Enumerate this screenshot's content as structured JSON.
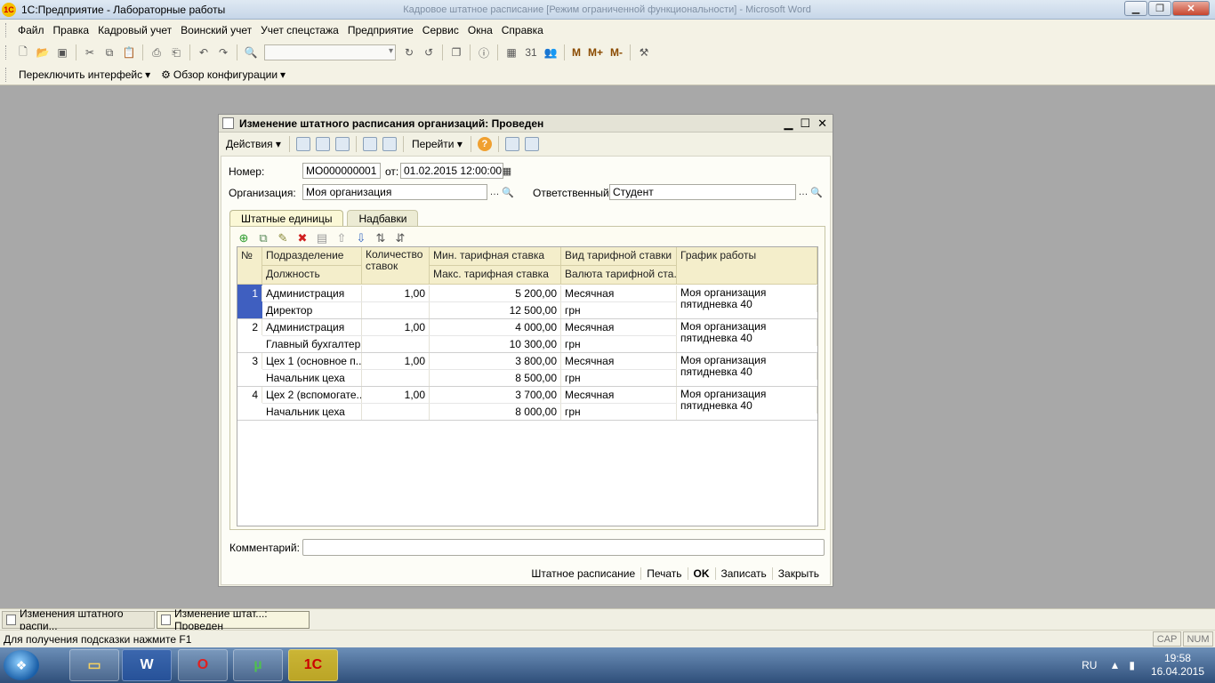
{
  "app": {
    "logo_text": "1С",
    "title": "1С:Предприятие - Лабораторные работы",
    "faded_title": "Кадровое штатное расписание [Режим ограниченной функциональности] - Microsoft Word"
  },
  "menu": {
    "items": [
      "Файл",
      "Правка",
      "Кадровый учет",
      "Воинский учет",
      "Учет спецстажа",
      "Предприятие",
      "Сервис",
      "Окна",
      "Справка"
    ]
  },
  "toolbar": {
    "m_labels": [
      "M",
      "M+",
      "M-"
    ]
  },
  "toolbar2": {
    "switch_interface": "Переключить интерфейс",
    "config_overview": "Обзор конфигурации"
  },
  "document": {
    "title": "Изменение штатного расписания организаций: Проведен",
    "toolbar": {
      "actions": "Действия",
      "goto": "Перейти"
    },
    "number_label": "Номер:",
    "number_value": "МО000000001",
    "from_label": "от:",
    "date_value": "01.02.2015 12:00:00",
    "org_label": "Организация:",
    "org_value": "Моя организация",
    "resp_label": "Ответственный:",
    "resp_value": "Студент",
    "tabs": [
      "Штатные единицы",
      "Надбавки"
    ],
    "grid": {
      "headers": {
        "num": "№",
        "dept": "Подразделение",
        "position": "Должность",
        "count": "Количество ставок",
        "min_rate": "Мин. тарифная ставка",
        "max_rate": "Макс. тарифная ставка",
        "rate_type": "Вид тарифной ставки",
        "currency": "Валюта тарифной ста...",
        "schedule": "График работы"
      },
      "rows": [
        {
          "num": "1",
          "dept": "Администрация",
          "position": "Директор",
          "count": "1,00",
          "min_rate": "5 200,00",
          "max_rate": "12 500,00",
          "rate_type": "Месячная",
          "currency": "грн",
          "schedule_line1": "Моя организация",
          "schedule_line2": "пятидневка 40"
        },
        {
          "num": "2",
          "dept": "Администрация",
          "position": "Главный бухгалтер",
          "count": "1,00",
          "min_rate": "4 000,00",
          "max_rate": "10 300,00",
          "rate_type": "Месячная",
          "currency": "грн",
          "schedule_line1": "Моя организация",
          "schedule_line2": "пятидневка 40"
        },
        {
          "num": "3",
          "dept": "Цех 1 (основное п...",
          "position": "Начальник цеха",
          "count": "1,00",
          "min_rate": "3 800,00",
          "max_rate": "8 500,00",
          "rate_type": "Месячная",
          "currency": "грн",
          "schedule_line1": "Моя организация",
          "schedule_line2": "пятидневка 40"
        },
        {
          "num": "4",
          "dept": "Цех 2 (вспомогате...",
          "position": "Начальник цеха",
          "count": "1,00",
          "min_rate": "3 700,00",
          "max_rate": "8 000,00",
          "rate_type": "Месячная",
          "currency": "грн",
          "schedule_line1": "Моя организация",
          "schedule_line2": "пятидневка 40"
        }
      ]
    },
    "comment_label": "Комментарий:",
    "comment_value": "",
    "footer": {
      "staff_schedule": "Штатное расписание",
      "print": "Печать",
      "ok": "OK",
      "save": "Записать",
      "close": "Закрыть"
    }
  },
  "window_list": [
    {
      "label": "Изменения штатного распи..."
    },
    {
      "label": "Изменение штат...: Проведен"
    }
  ],
  "status": {
    "hint": "Для получения подсказки нажмите F1",
    "cap": "CAP",
    "num": "NUM"
  },
  "taskbar": {
    "lang": "RU",
    "time": "19:58",
    "date": "16.04.2015",
    "apps": [
      "Проводник",
      "W",
      "O",
      "µ",
      "1С"
    ]
  }
}
